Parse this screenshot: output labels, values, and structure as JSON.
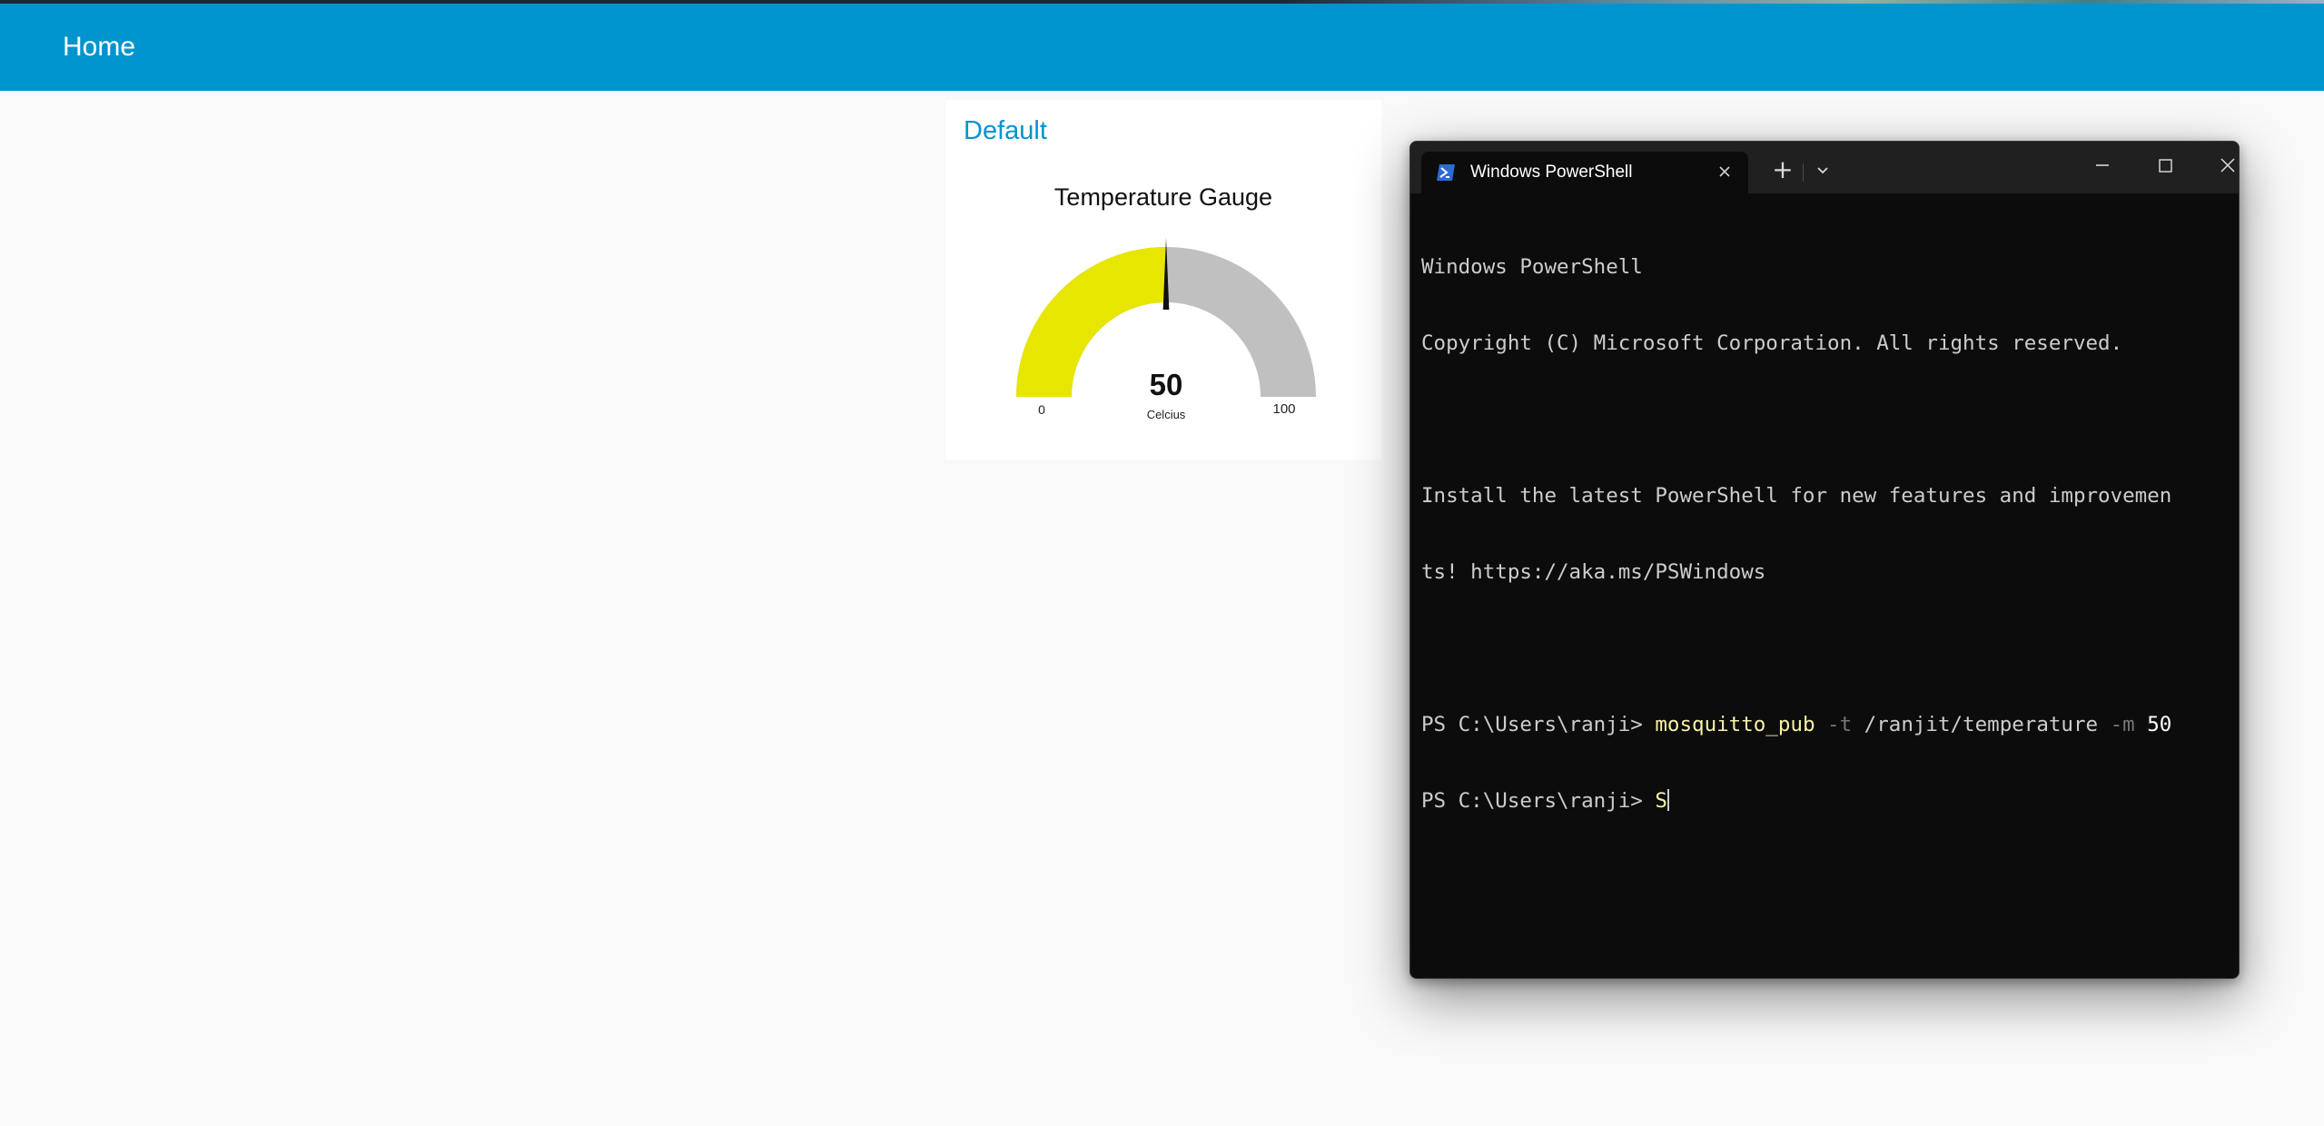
{
  "app": {
    "header_title": "Home",
    "accent_color": "#0094ce"
  },
  "dashboard": {
    "group_label": "Default",
    "gauge": {
      "title": "Temperature Gauge",
      "value": "50",
      "value_numeric": 50,
      "units": "Celcius",
      "min_label": "0",
      "max_label": "100",
      "min": 0,
      "max": 100,
      "fill_color": "#e6e600",
      "track_color": "#c0c0c0"
    }
  },
  "terminal": {
    "tab_title": "Windows PowerShell",
    "tab_icon": "powershell-icon",
    "new_tab_label": "+",
    "lines": {
      "l1": "Windows PowerShell",
      "l2": "Copyright (C) Microsoft Corporation. All rights reserved.",
      "l4": "Install the latest PowerShell for new features and improvemen",
      "l5": "ts! https://aka.ms/PSWindows",
      "prompt": "PS C:\\Users\\ranji> ",
      "cmd_name": "mosquitto_pub",
      "cmd_flag_t": " -t",
      "cmd_topic": " /ranjit/temperature",
      "cmd_flag_m": " -m",
      "cmd_value": " 50",
      "current_input": "S"
    }
  }
}
